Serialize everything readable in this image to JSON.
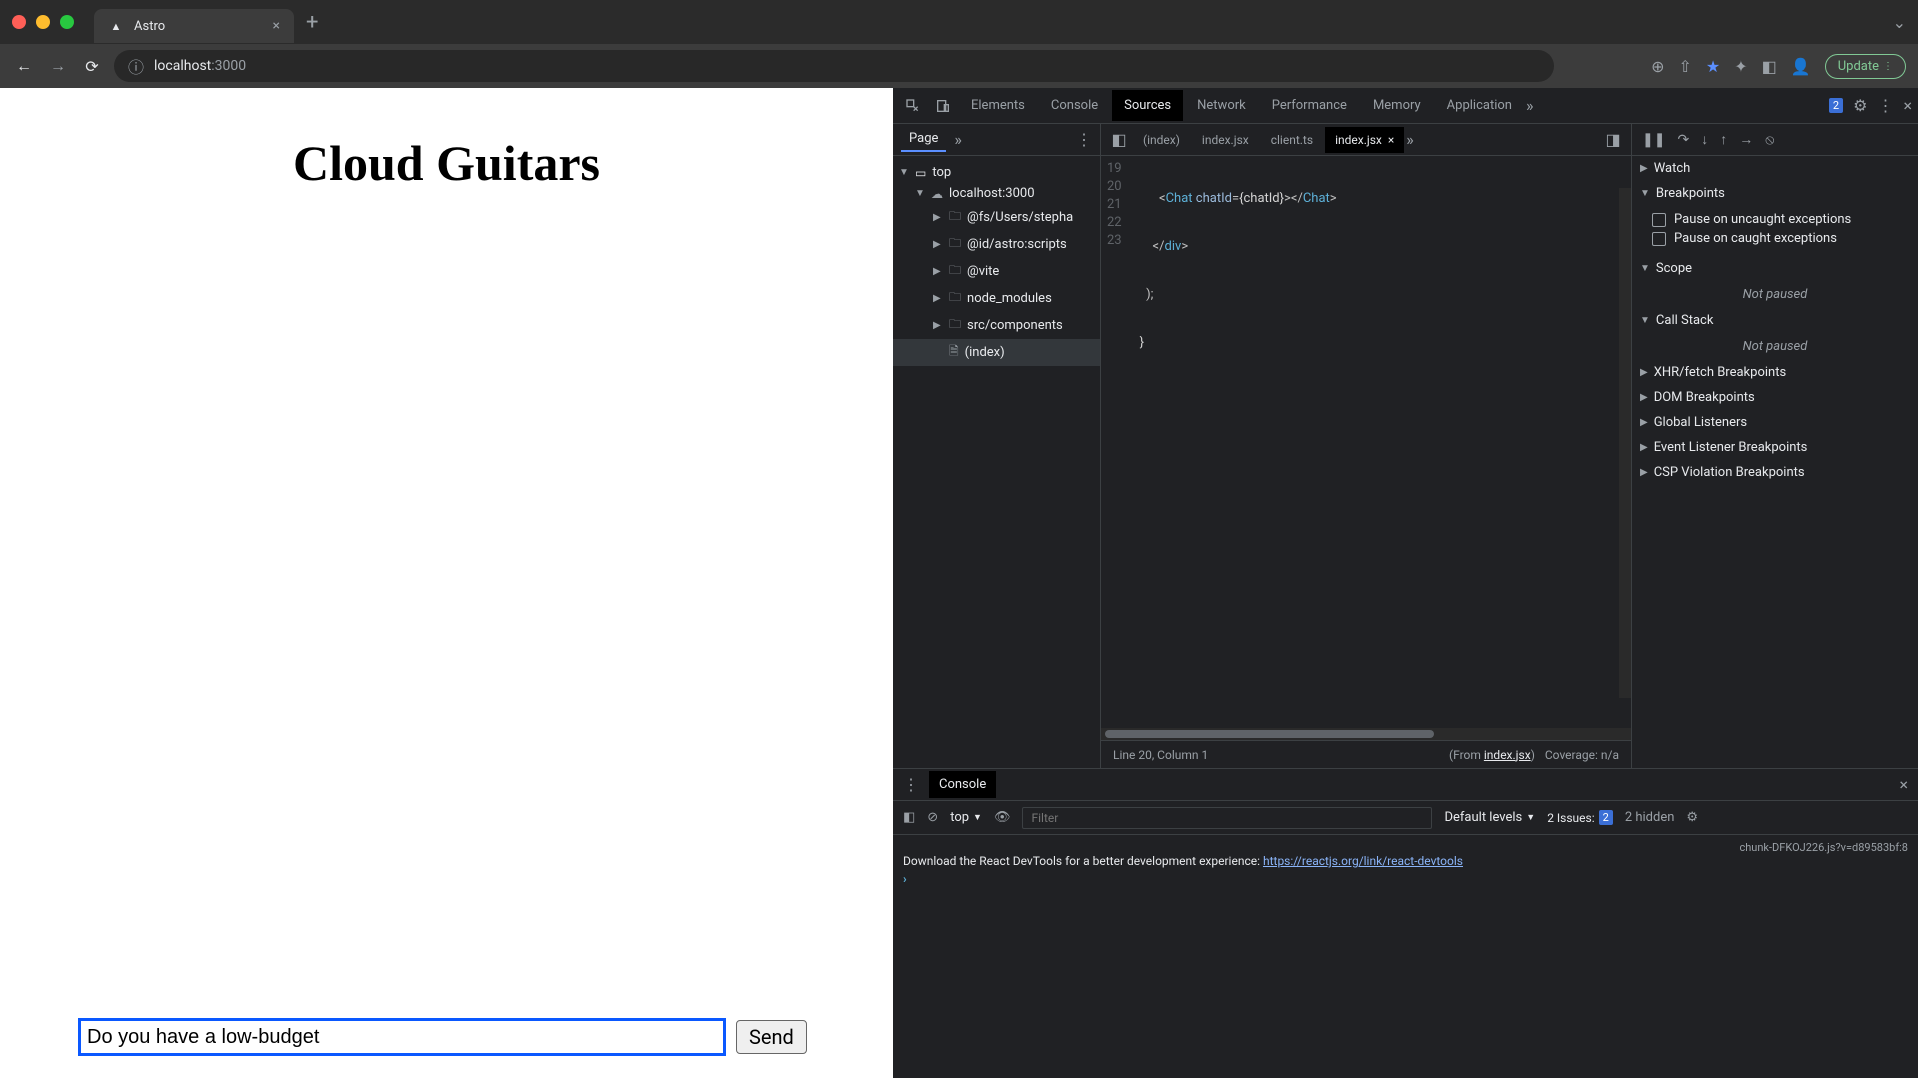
{
  "browser": {
    "tab_title": "Astro",
    "url_host": "localhost",
    "url_port": ":3000",
    "update_label": "Update"
  },
  "page": {
    "title": "Cloud Guitars",
    "input_value": "Do you have a low-budget",
    "send_label": "Send"
  },
  "devtools": {
    "tabs": {
      "elements": "Elements",
      "console": "Console",
      "sources": "Sources",
      "network": "Network",
      "performance": "Performance",
      "memory": "Memory",
      "application": "Application"
    },
    "issues_count": "2",
    "file_nav": {
      "page_tab": "Page",
      "tree": {
        "top": "top",
        "host": "localhost:3000",
        "fs": "@fs/Users/stepha",
        "astro": "@id/astro:scripts",
        "vite": "@vite",
        "node_modules": "node_modules",
        "src_components": "src/components",
        "index": "(index)"
      }
    },
    "editor": {
      "tabs": {
        "index_html": "(index)",
        "index_jsx_1": "index.jsx",
        "client_ts": "client.ts",
        "index_jsx_2": "index.jsx"
      },
      "lines": {
        "l19": "19",
        "l20": "20",
        "l21": "21",
        "l22": "22",
        "l23": "23"
      },
      "code": {
        "chat_open": "Chat",
        "chat_attr": "chatId",
        "chat_expr": "{chatId}",
        "chat_close": "Chat",
        "div_close": "div",
        "paren": ");",
        "brace": "}"
      },
      "status_line": "Line 20, Column 1",
      "status_from": "(From ",
      "status_file": "index.jsx",
      "status_close": ")",
      "coverage": "Coverage: n/a"
    },
    "debug": {
      "watch": "Watch",
      "breakpoints": "Breakpoints",
      "pause_uncaught": "Pause on uncaught exceptions",
      "pause_caught": "Pause on caught exceptions",
      "scope": "Scope",
      "not_paused": "Not paused",
      "call_stack": "Call Stack",
      "xhr": "XHR/fetch Breakpoints",
      "dom": "DOM Breakpoints",
      "global": "Global Listeners",
      "event": "Event Listener Breakpoints",
      "csp": "CSP Violation Breakpoints"
    },
    "console": {
      "tab": "Console",
      "context": "top",
      "filter_placeholder": "Filter",
      "levels": "Default levels",
      "issues_label": "2 Issues:",
      "issues_badge": "2",
      "hidden": "2 hidden",
      "source": "chunk-DFKOJ226.js?v=d89583bf:8",
      "msg": "Download the React DevTools for a better development experience: ",
      "link": "https://reactjs.org/link/react-devtools"
    }
  }
}
